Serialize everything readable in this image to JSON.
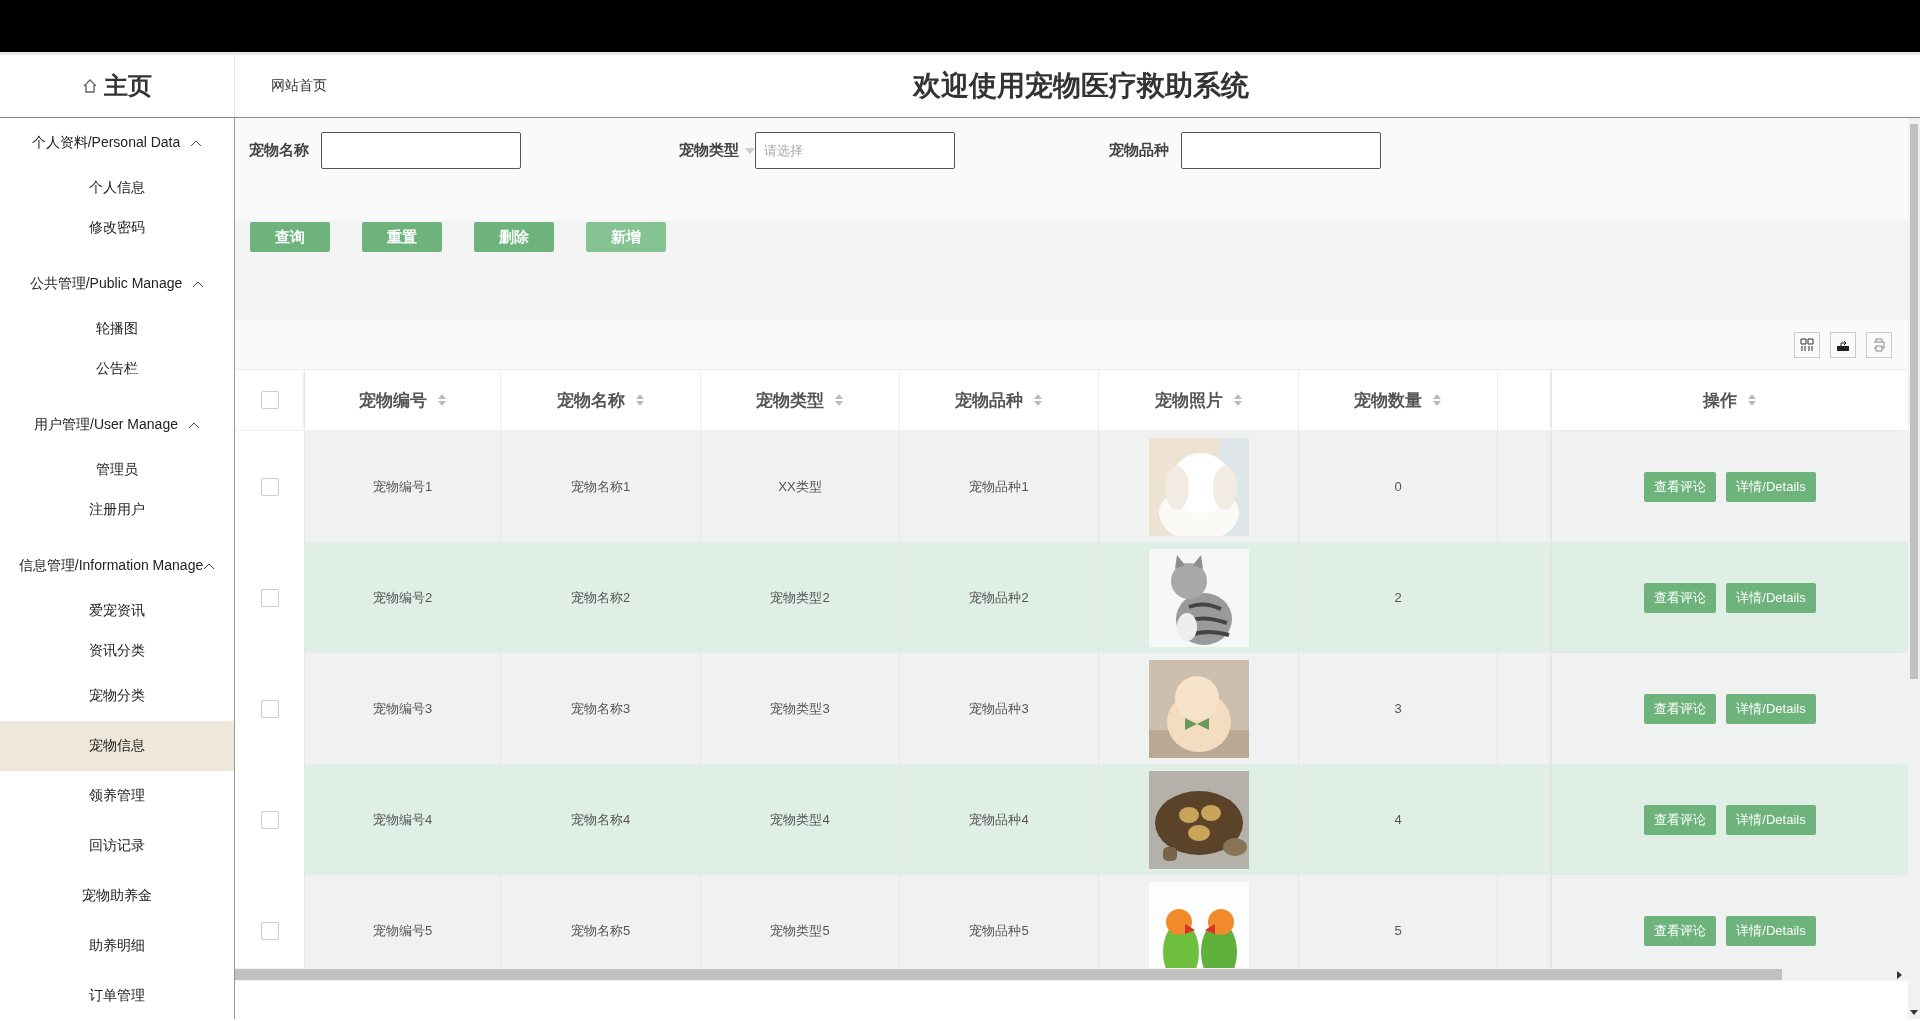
{
  "header": {
    "home": "主页",
    "breadcrumb": "网站首页",
    "title": "欢迎使用宠物医疗救助系统"
  },
  "sidebar": {
    "groups": [
      {
        "label": "个人资料/Personal Data",
        "expanded": true,
        "items": [
          {
            "label": "个人信息",
            "selected": false
          },
          {
            "label": "修改密码",
            "selected": false
          }
        ]
      },
      {
        "label": "公共管理/Public Manage",
        "expanded": true,
        "items": [
          {
            "label": "轮播图",
            "selected": false
          },
          {
            "label": "公告栏",
            "selected": false
          }
        ]
      },
      {
        "label": "用户管理/User Manage",
        "expanded": true,
        "items": [
          {
            "label": "管理员",
            "selected": false
          },
          {
            "label": "注册用户",
            "selected": false
          }
        ]
      },
      {
        "label": "信息管理/Information Manage",
        "expanded": true,
        "items": [
          {
            "label": "爱宠资讯",
            "selected": false
          },
          {
            "label": "资讯分类",
            "selected": false
          },
          {
            "label": "宠物分类",
            "selected": false
          },
          {
            "label": "宠物信息",
            "selected": true
          },
          {
            "label": "领养管理",
            "selected": false
          },
          {
            "label": "回访记录",
            "selected": false
          },
          {
            "label": "宠物助养金",
            "selected": false
          },
          {
            "label": "助养明细",
            "selected": false
          },
          {
            "label": "订单管理",
            "selected": false
          }
        ]
      }
    ]
  },
  "search": {
    "fields": [
      {
        "label": "宠物名称",
        "kind": "text"
      },
      {
        "label": "宠物类型",
        "kind": "select",
        "placeholder": "请选择"
      },
      {
        "label": "宠物品种",
        "kind": "text"
      }
    ]
  },
  "actions": [
    {
      "label": "查询",
      "hovered": false
    },
    {
      "label": "重置",
      "hovered": false
    },
    {
      "label": "删除",
      "hovered": false
    },
    {
      "label": "新增",
      "hovered": true
    }
  ],
  "toolbar": [
    {
      "kind": "columns"
    },
    {
      "kind": "export"
    },
    {
      "kind": "print"
    }
  ],
  "table": {
    "select_all_checked": false,
    "columns": [
      {
        "label": "宠物编号",
        "sortable": true
      },
      {
        "label": "宠物名称",
        "sortable": true
      },
      {
        "label": "宠物类型",
        "sortable": true
      },
      {
        "label": "宠物品种",
        "sortable": true
      },
      {
        "label": "宠物照片",
        "sortable": true
      },
      {
        "label": "宠物数量",
        "sortable": true
      },
      {
        "label": "操作",
        "sortable": true
      }
    ],
    "rows": [
      {
        "checked": false,
        "number": "宠物编号1",
        "name": "宠物名称1",
        "type": "XX类型",
        "breed": "宠物品种1",
        "photo": {
          "kind": "picture"
        },
        "quantity": "0",
        "actions": [
          "查看评论",
          "详情/Details"
        ]
      },
      {
        "checked": false,
        "number": "宠物编号2",
        "name": "宠物名称2",
        "type": "宠物类型2",
        "breed": "宠物品种2",
        "photo": {
          "kind": "picture"
        },
        "quantity": "2",
        "actions": [
          "查看评论",
          "详情/Details"
        ]
      },
      {
        "checked": false,
        "number": "宠物编号3",
        "name": "宠物名称3",
        "type": "宠物类型3",
        "breed": "宠物品种3",
        "photo": {
          "kind": "picture"
        },
        "quantity": "3",
        "actions": [
          "查看评论",
          "详情/Details"
        ]
      },
      {
        "checked": false,
        "number": "宠物编号4",
        "name": "宠物名称4",
        "type": "宠物类型4",
        "breed": "宠物品种4",
        "photo": {
          "kind": "picture"
        },
        "quantity": "4",
        "actions": [
          "查看评论",
          "详情/Details"
        ]
      },
      {
        "checked": false,
        "number": "宠物编号5",
        "name": "宠物名称5",
        "type": "宠物类型5",
        "breed": "宠物品种5",
        "photo": {
          "kind": "picture"
        },
        "quantity": "5",
        "actions": [
          "查看评论",
          "详情/Details"
        ]
      }
    ]
  }
}
